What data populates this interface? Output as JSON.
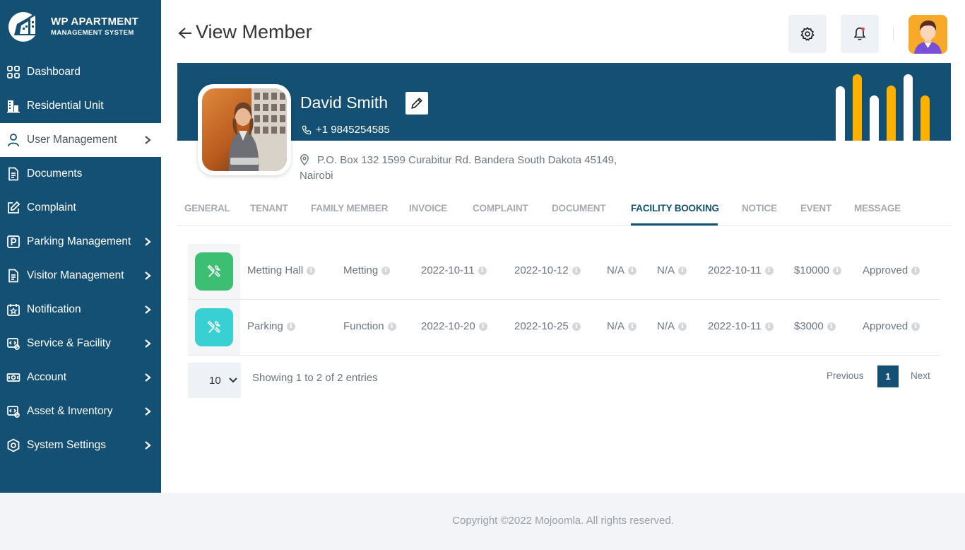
{
  "app": {
    "logo_title": "WP APARTMENT",
    "logo_subtitle": "MANAGEMENT SYSTEM"
  },
  "sidebar": {
    "items": [
      {
        "label": "Dashboard",
        "icon": "dashboard-grid-icon",
        "has_chevron": false
      },
      {
        "label": "Residential Unit",
        "icon": "building-icon",
        "has_chevron": false
      },
      {
        "label": "User Management",
        "icon": "user-icon",
        "has_chevron": true,
        "active": true
      },
      {
        "label": "Documents",
        "icon": "document-icon",
        "has_chevron": false
      },
      {
        "label": "Complaint",
        "icon": "complaint-edit-icon",
        "has_chevron": false
      },
      {
        "label": "Parking Management",
        "icon": "parking-icon",
        "has_chevron": true
      },
      {
        "label": "Visitor Management",
        "icon": "visitor-doc-icon",
        "has_chevron": true
      },
      {
        "label": "Notification",
        "icon": "calendar-notification-icon",
        "has_chevron": true
      },
      {
        "label": "Service & Facility",
        "icon": "service-icon",
        "has_chevron": true
      },
      {
        "label": "Account",
        "icon": "account-cash-icon",
        "has_chevron": true
      },
      {
        "label": "Asset & Inventory",
        "icon": "asset-icon",
        "has_chevron": true
      },
      {
        "label": "System Settings",
        "icon": "settings-icon",
        "has_chevron": true
      }
    ]
  },
  "header": {
    "title": "View Member",
    "back_icon": "arrow-left-icon",
    "settings_icon": "gear-icon",
    "notification_icon": "bell-icon"
  },
  "member": {
    "name": "David Smith",
    "phone": "+1  9845254585",
    "address": "P.O. Box 132 1599 Curabitur Rd. Bandera South Dakota 45149, Nairobi"
  },
  "tabs": [
    {
      "label": "GENERAL"
    },
    {
      "label": "TENANT"
    },
    {
      "label": "FAMILY MEMBER"
    },
    {
      "label": "INVOICE"
    },
    {
      "label": "COMPLAINT"
    },
    {
      "label": "DOCUMENT"
    },
    {
      "label": "FACILITY BOOKING",
      "active": true
    },
    {
      "label": "NOTICE"
    },
    {
      "label": "EVENT"
    },
    {
      "label": "MESSAGE"
    }
  ],
  "bookings": [
    {
      "icon_color": "#3cbf72",
      "facility": "Metting Hall",
      "type": "Metting",
      "start_date": "2022-10-11",
      "end_date": "2022-10-12",
      "col5": "N/A",
      "col6": "N/A",
      "booked_on": "2022-10-11",
      "amount": "$10000",
      "status": "Approved"
    },
    {
      "icon_color": "#38d0d3",
      "facility": "Parking",
      "type": "Function",
      "start_date": "2022-10-20",
      "end_date": "2022-10-25",
      "col5": "N/A",
      "col6": "N/A",
      "booked_on": "2022-10-11",
      "amount": "$3000",
      "status": "Approved"
    }
  ],
  "pagination": {
    "page_size": "10",
    "entries_text": "Showing 1 to 2 of 2 entries",
    "previous_label": "Previous",
    "current_page": "1",
    "next_label": "Next"
  },
  "footer": {
    "copyright": "Copyright ©2022 Mojoomla. All rights reserved."
  },
  "colors": {
    "primary": "#135073",
    "accent": "#ffb100"
  }
}
